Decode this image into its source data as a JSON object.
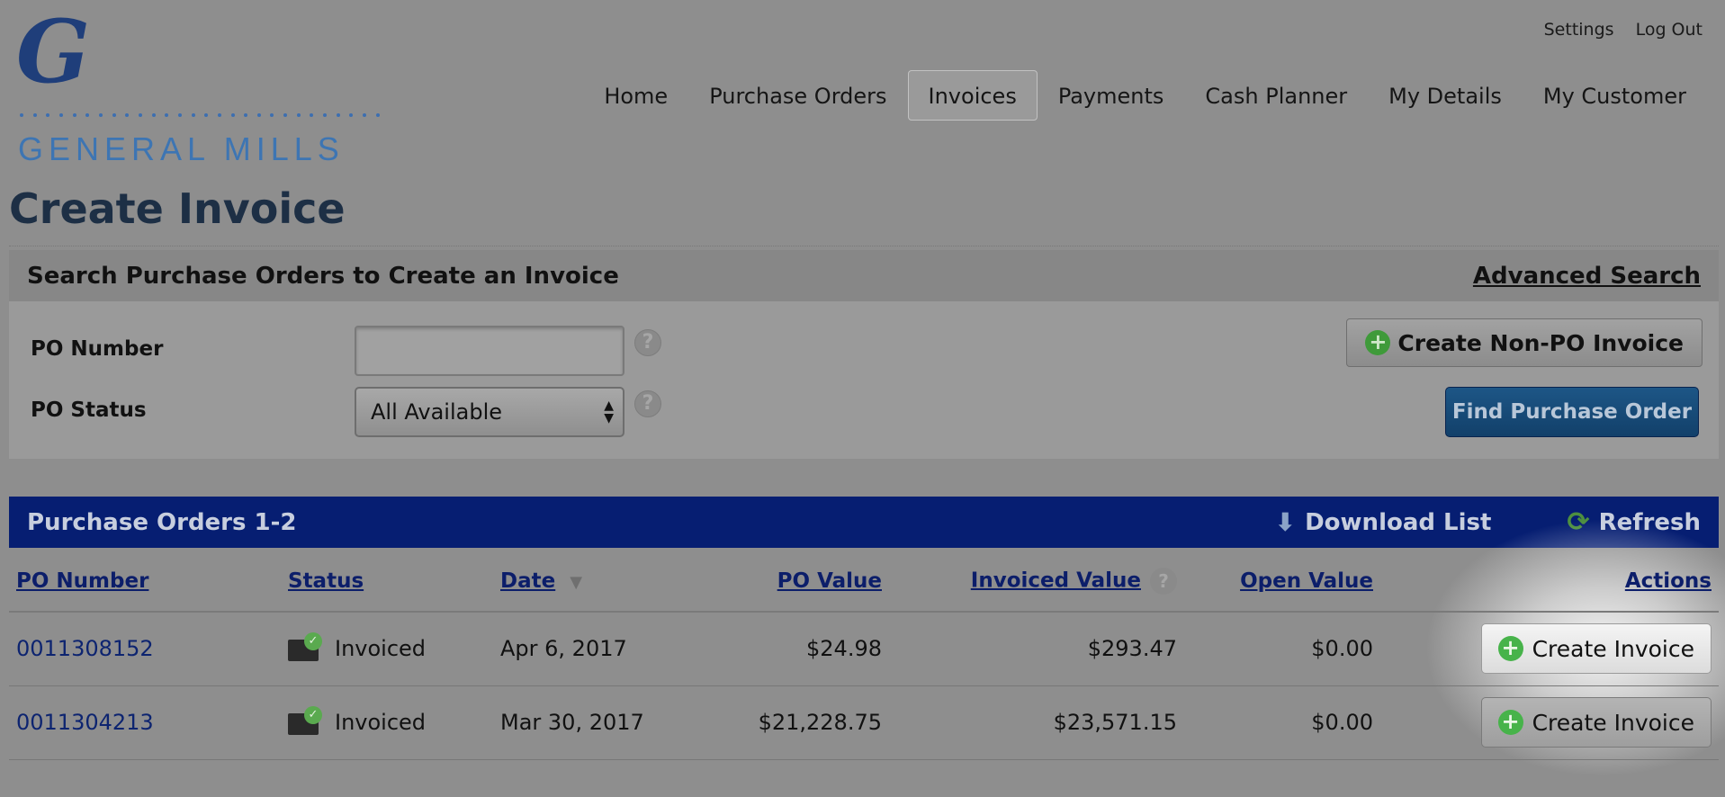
{
  "logo": {
    "glyph": "G",
    "text": "GENERAL MILLS"
  },
  "top_links": {
    "settings": "Settings",
    "logout": "Log Out"
  },
  "nav": {
    "items": [
      "Home",
      "Purchase Orders",
      "Invoices",
      "Payments",
      "Cash Planner",
      "My Details",
      "My Customer"
    ],
    "active": "Invoices"
  },
  "page_title": "Create Invoice",
  "search": {
    "heading": "Search Purchase Orders to Create an Invoice",
    "advanced_link": "Advanced Search",
    "po_number_label": "PO Number",
    "po_number_value": "",
    "po_status_label": "PO Status",
    "po_status_selected": "All Available",
    "help_glyph": "?",
    "create_non_po_label": "Create Non-PO Invoice",
    "find_label": "Find Purchase Order"
  },
  "po_list": {
    "title": "Purchase Orders 1-2",
    "download_label": "Download List",
    "refresh_label": "Refresh",
    "columns": {
      "po_number": "PO Number",
      "status": "Status",
      "date": "Date",
      "po_value": "PO Value",
      "invoiced_value": "Invoiced Value",
      "open_value": "Open Value",
      "actions": "Actions"
    },
    "rows": [
      {
        "po_number": "0011308152",
        "status": "Invoiced",
        "date": "Apr 6, 2017",
        "po_value": "$24.98",
        "invoiced_value": "$293.47",
        "open_value": "$0.00",
        "action": "Create Invoice"
      },
      {
        "po_number": "0011304213",
        "status": "Invoiced",
        "date": "Mar 30, 2017",
        "po_value": "$21,228.75",
        "invoiced_value": "$23,571.15",
        "open_value": "$0.00",
        "action": "Create Invoice"
      }
    ]
  },
  "colors": {
    "header_bar": "#061e72",
    "find_button": "#12406a",
    "add_green": "#47b34a"
  }
}
